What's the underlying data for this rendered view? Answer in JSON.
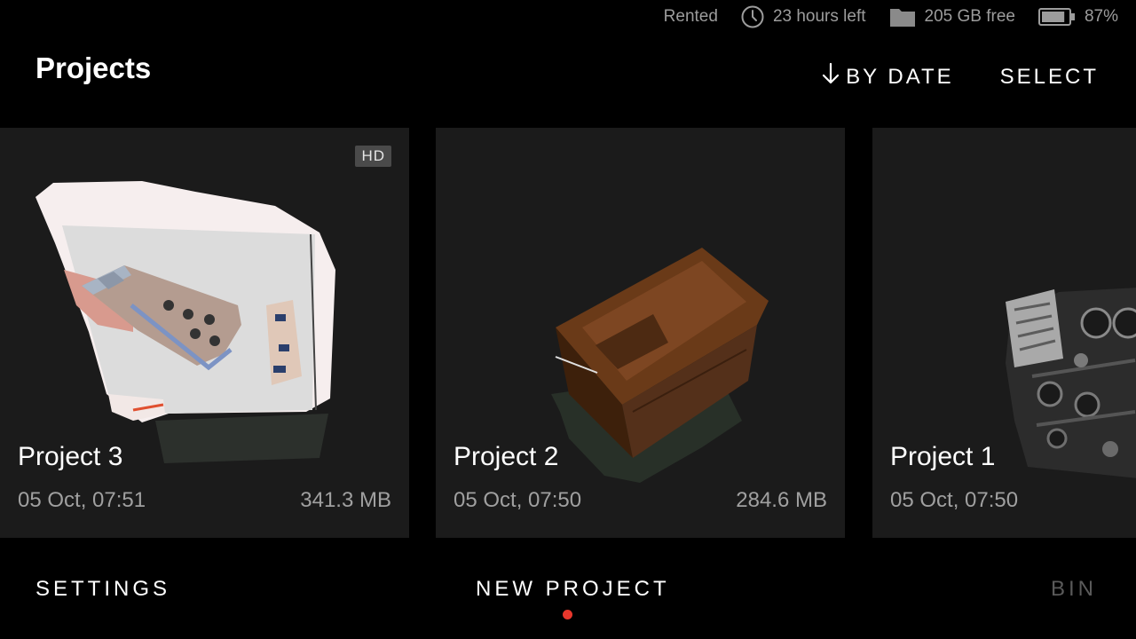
{
  "status": {
    "rental": "Rented",
    "time_left": "23 hours left",
    "storage_free": "205 GB free",
    "battery": "87%",
    "battery_level": 0.87
  },
  "header": {
    "title": "Projects",
    "sort_label": "BY DATE",
    "select_label": "SELECT"
  },
  "projects": [
    {
      "name": "Project 3",
      "date": "05 Oct, 07:51",
      "size": "341.3 MB",
      "badge": "HD"
    },
    {
      "name": "Project 2",
      "date": "05 Oct, 07:50",
      "size": "284.6 MB"
    },
    {
      "name": "Project 1",
      "date": "05 Oct, 07:50"
    }
  ],
  "bottom": {
    "settings_label": "SETTINGS",
    "new_project_label": "NEW PROJECT",
    "bin_label": "BIN"
  },
  "colors": {
    "background": "#000000",
    "card": "#1b1b1b",
    "accent_dot": "#e8372c",
    "muted_text": "#a0a0a0"
  }
}
